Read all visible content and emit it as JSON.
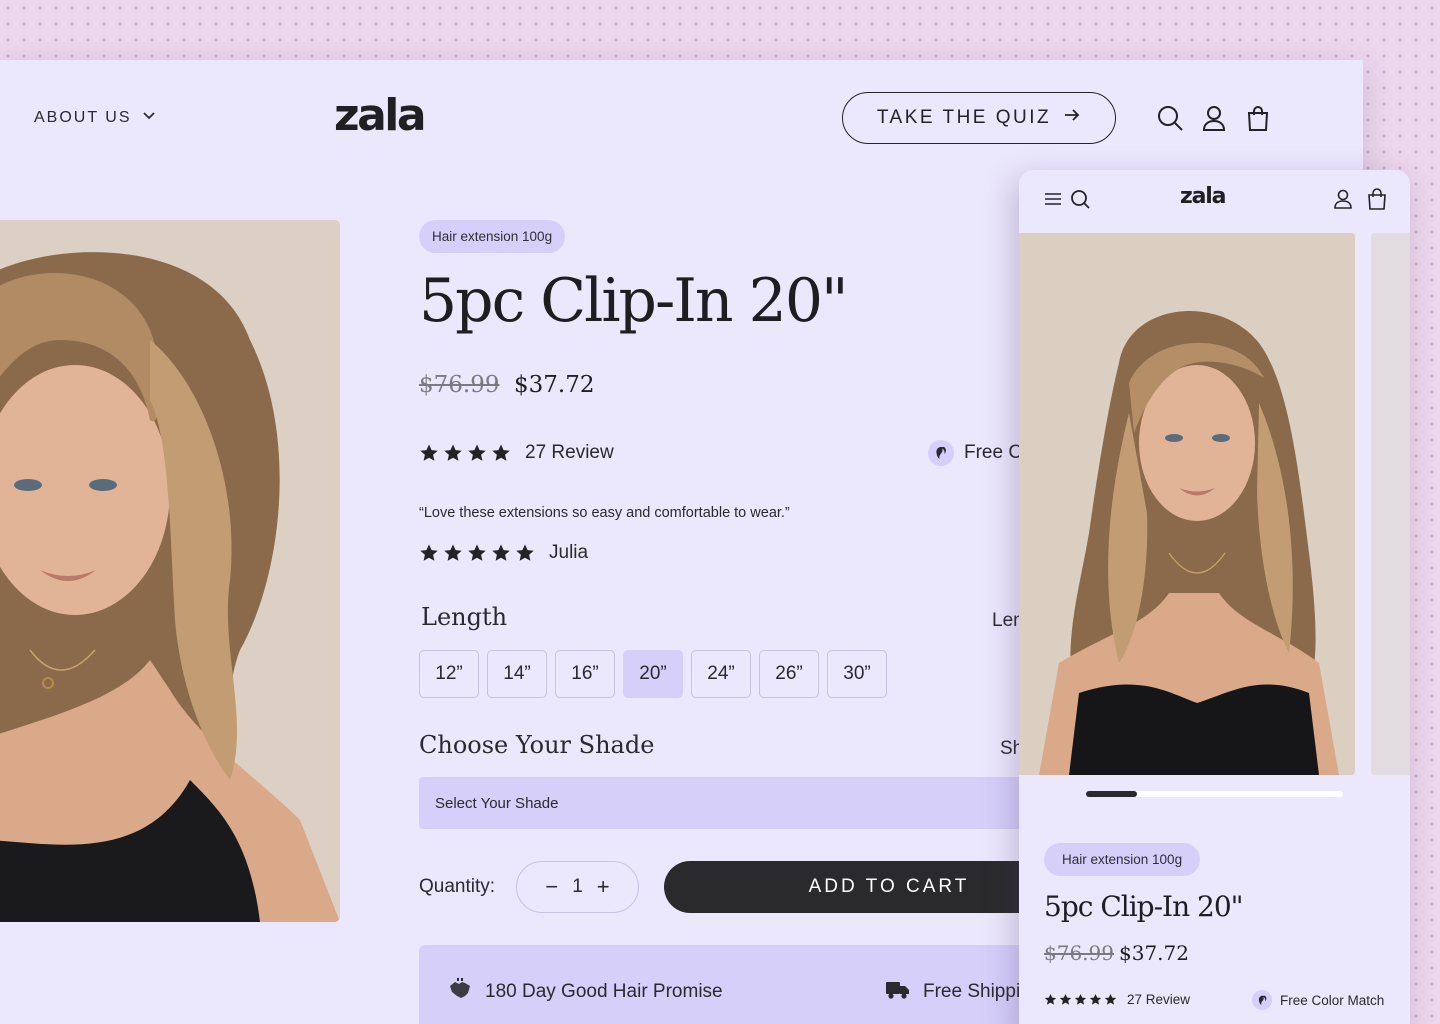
{
  "brand": "zala",
  "nav": {
    "about_label": "ABOUT US",
    "quiz_label": "TAKE THE QUIZ"
  },
  "product": {
    "badge": "Hair extension 100g",
    "title": "5pc Clip-In 20\"",
    "price_old": "$76.99",
    "price_new": "$37.72",
    "rating_stars": 4,
    "review_count": "27 Review",
    "color_match": "Free Color Match",
    "quote": "“Love these extensions so easy and comfortable to wear.”",
    "reviewer_stars": 5,
    "reviewer": "Julia",
    "length_label": "Length",
    "length_guide": "Length Guide",
    "sizes": [
      "12”",
      "14”",
      "16”",
      "20”",
      "24”",
      "26”",
      "30”"
    ],
    "selected_size": "20”",
    "shade_label": "Choose Your Shade",
    "shade_guide": "Shade Guide",
    "shade_placeholder": "Select Your Shade",
    "quantity_label": "Quantity:",
    "quantity_value": "1",
    "qty_minus": "−",
    "qty_plus": "+",
    "add_to_cart": "ADD TO CART",
    "promise_1": "180 Day Good Hair Promise",
    "promise_2": "Free Shipping"
  },
  "mobile": {
    "carousel_progress": 0.2
  },
  "colors": {
    "page_bg": "#ebe7fc",
    "accent": "#d6cffa",
    "dark": "#2a2a2c"
  }
}
